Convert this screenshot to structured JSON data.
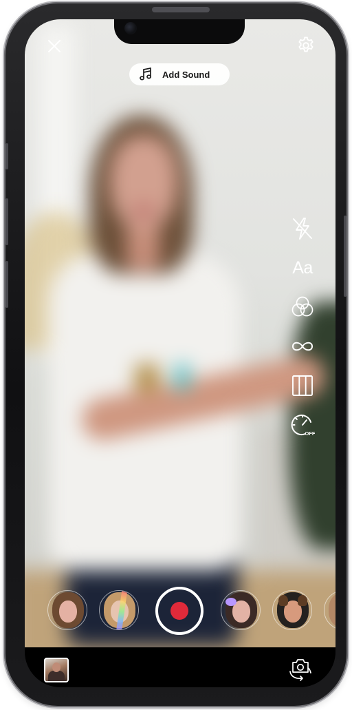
{
  "top_bar": {
    "close_icon": "close-icon",
    "settings_icon": "gear-icon"
  },
  "sound": {
    "label": "Add Sound",
    "icon": "music-note-icon"
  },
  "right_rail": {
    "items": [
      {
        "name": "flash-off",
        "icon": "flash-off-icon"
      },
      {
        "name": "text",
        "label": "Aa",
        "icon": "text-icon"
      },
      {
        "name": "effects",
        "icon": "color-circles-icon"
      },
      {
        "name": "boomerang",
        "icon": "infinity-icon"
      },
      {
        "name": "layout",
        "icon": "grid-columns-icon"
      },
      {
        "name": "timer",
        "label": "OFF",
        "icon": "timer-off-icon"
      }
    ]
  },
  "filters": [
    {
      "name": "filter-blush",
      "colors": {
        "hair": "#6d4a31",
        "face": "#e4b1a3"
      }
    },
    {
      "name": "filter-rainbow",
      "colors": {
        "hair": "#c49a6a",
        "face": "#e6c4b0"
      }
    },
    {
      "name": "filter-butterfly",
      "colors": {
        "hair": "#3b2a26",
        "face": "#e2b2a5"
      }
    },
    {
      "name": "filter-dog",
      "colors": {
        "hair": "#24211f",
        "face": "#d79a7d"
      }
    },
    {
      "name": "filter-partial",
      "colors": {
        "hair": "#b48866",
        "face": "#d9b09a"
      }
    }
  ],
  "record": {
    "icon": "record-icon",
    "accent": "#e02a3a"
  },
  "bottom_bar": {
    "gallery_icon": "gallery-thumbnail-icon",
    "flip_icon": "flip-camera-icon"
  }
}
